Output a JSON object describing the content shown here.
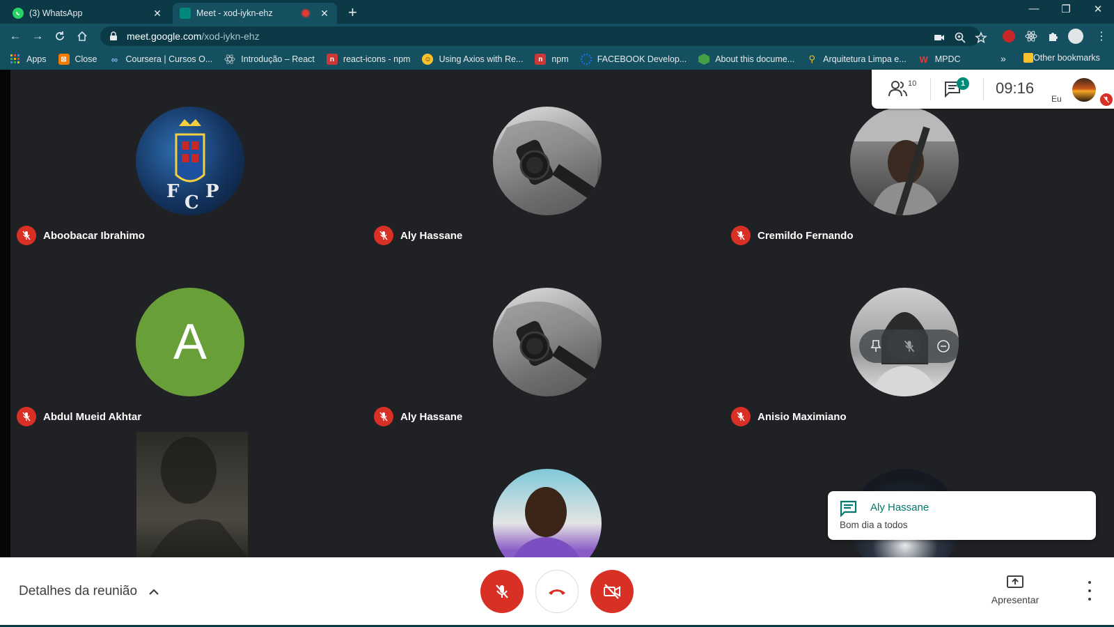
{
  "browser": {
    "tabs": [
      {
        "title": "(3) WhatsApp",
        "icon": "whatsapp-icon",
        "active": false
      },
      {
        "title": "Meet - xod-iykn-ehz",
        "icon": "meet-icon",
        "active": true,
        "recording": true
      }
    ],
    "url_host": "meet.google.com",
    "url_path": "/xod-iykn-ehz",
    "bookmarks": [
      {
        "label": "Apps",
        "icon": "apps-grid-icon",
        "color": "#f4b400"
      },
      {
        "label": "Close",
        "icon": "close-bookmark-icon",
        "color": "#f57c00"
      },
      {
        "label": "Coursera | Cursos O...",
        "icon": "coursera-icon",
        "color": "#8ab4f8"
      },
      {
        "label": "Introdução – React",
        "icon": "react-icon",
        "color": "#61dafb"
      },
      {
        "label": "react-icons - npm",
        "icon": "npm-icon",
        "color": "#cb3837"
      },
      {
        "label": "Using Axios with Re...",
        "icon": "axios-icon",
        "color": "#fbc02d"
      },
      {
        "label": "npm",
        "icon": "npm-icon",
        "color": "#cb3837"
      },
      {
        "label": "FACEBOOK Develop...",
        "icon": "facebook-dev-icon",
        "color": "#1877f2"
      },
      {
        "label": "About this docume...",
        "icon": "node-icon",
        "color": "#43a047"
      },
      {
        "label": "Arquitetura Limpa e...",
        "icon": "bookmark-site-icon",
        "color": "#fbc02d"
      },
      {
        "label": "MPDC",
        "icon": "mpdc-icon",
        "color": "#e53935"
      }
    ],
    "other_bookmarks": "Other bookmarks",
    "more_chevron": "»"
  },
  "meet": {
    "participants": [
      {
        "name": "Aboobacar Ibrahimo",
        "muted": true,
        "avatar": "crest-photo"
      },
      {
        "name": "Aly Hassane",
        "muted": true,
        "avatar": "watch-photo"
      },
      {
        "name": "Cremildo Fernando",
        "muted": true,
        "avatar": "car-photo"
      },
      {
        "name": "Abdul Mueid Akhtar",
        "muted": true,
        "avatar": "letter",
        "letter": "A",
        "color": "#689f38"
      },
      {
        "name": "Aly Hassane",
        "muted": true,
        "avatar": "watch-photo"
      },
      {
        "name": "Anisio Maximiano",
        "muted": true,
        "avatar": "hood-photo",
        "hovered": true
      }
    ],
    "info_panel": {
      "people_count": "10",
      "chat_count": "1",
      "clock": "09:16",
      "self_label": "Eu"
    },
    "toast": {
      "sender": "Aly Hassane",
      "message": "Bom dia a todos"
    },
    "bottom": {
      "details_label": "Detalhes da reunião",
      "present_label": "Apresentar"
    },
    "colors": {
      "stage_bg": "#202124",
      "danger": "#d93025",
      "accent": "#00796b",
      "chrome_dark": "#0b3a46",
      "chrome_mid": "#14505f"
    }
  }
}
